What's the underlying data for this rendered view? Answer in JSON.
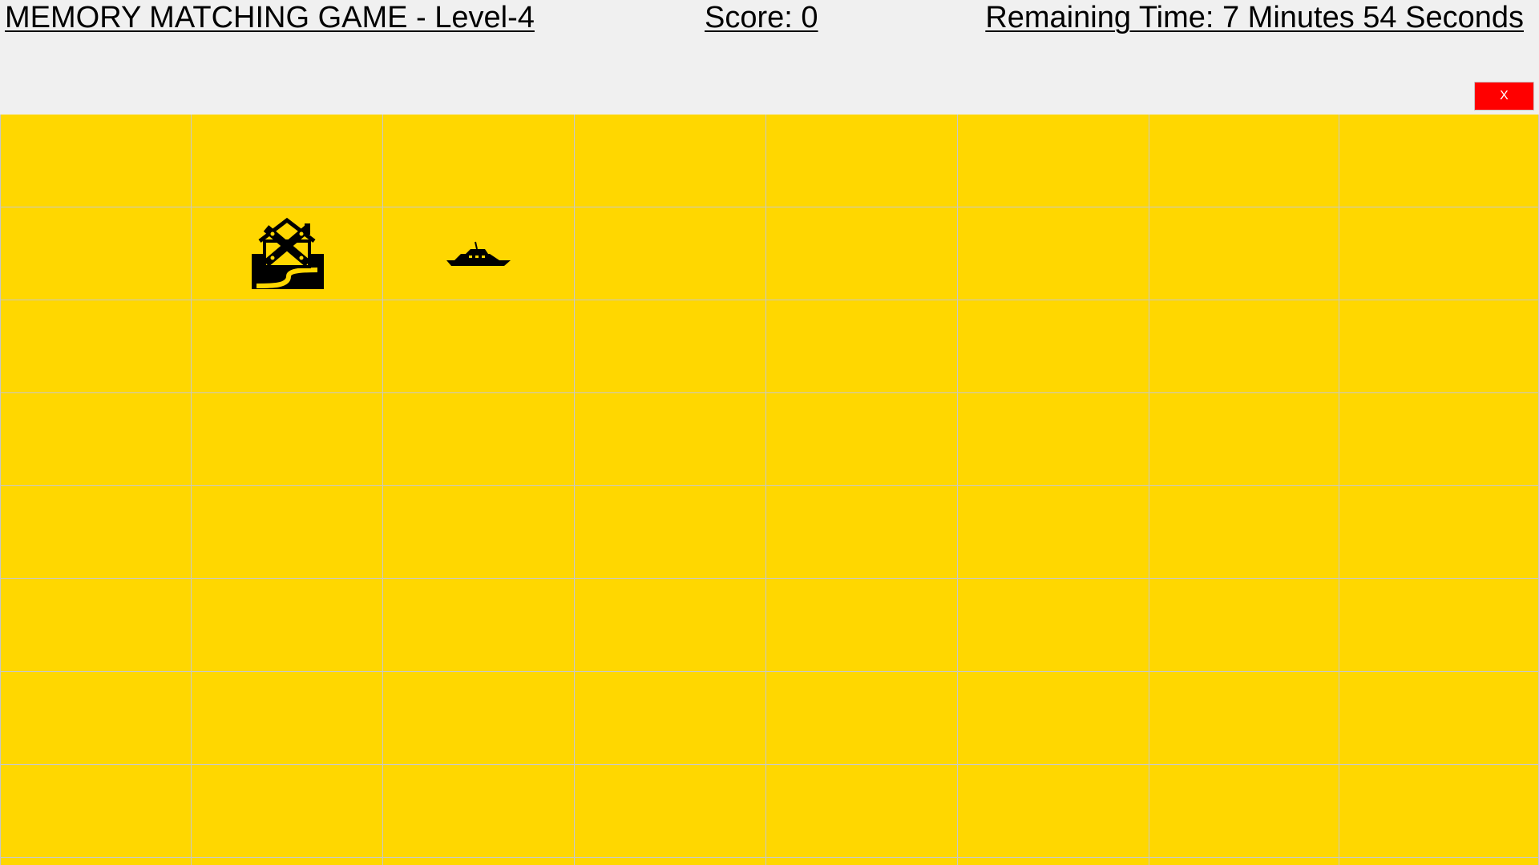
{
  "header": {
    "title": "MEMORY MATCHING GAME - Level-4",
    "score": "Score: 0",
    "remaining_time": "Remaining Time: 7 Minutes 54 Seconds",
    "close_label": "X"
  },
  "board": {
    "rows": 8,
    "columns": 8,
    "card_back_color": "#ffd700",
    "revealed_cards": [
      {
        "row": 1,
        "column": 1,
        "icon": "demolition-house-icon"
      },
      {
        "row": 1,
        "column": 2,
        "icon": "yacht-icon"
      }
    ]
  }
}
